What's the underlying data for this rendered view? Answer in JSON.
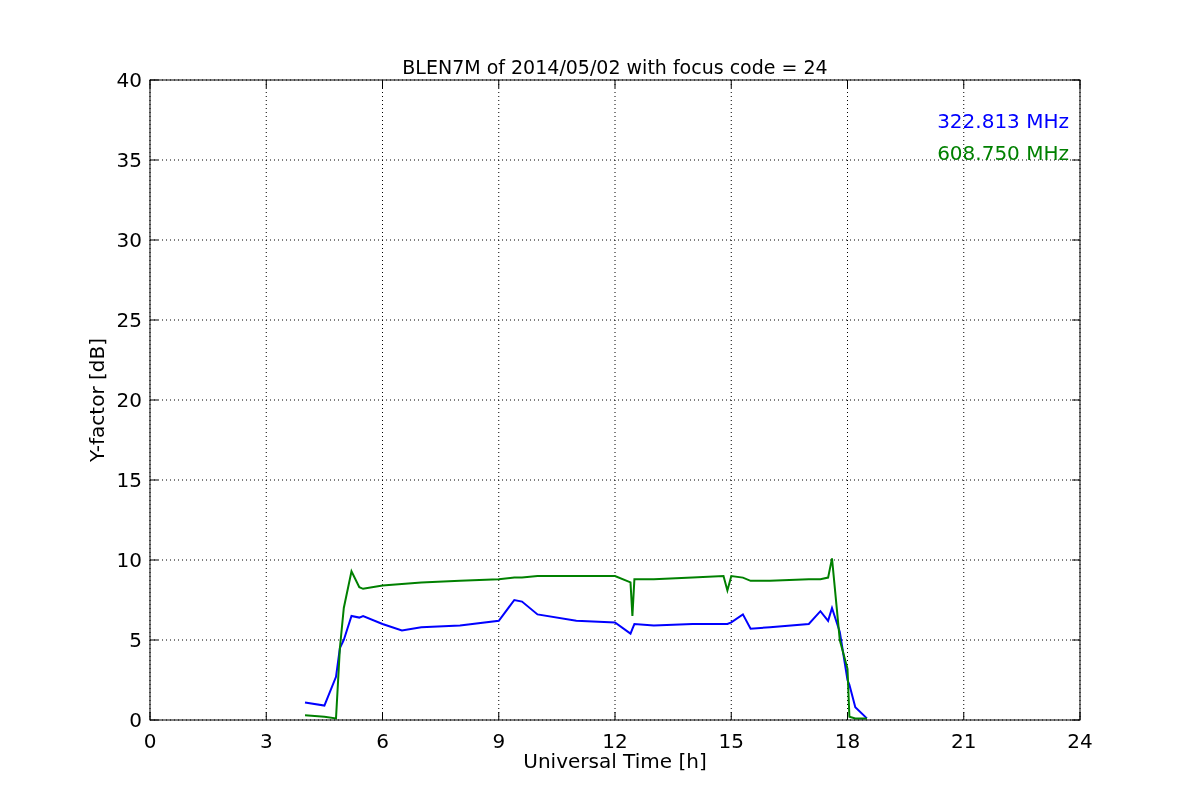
{
  "figure": {
    "chart_data": {
      "type": "line",
      "title": "BLEN7M of 2014/05/02 with focus code = 24",
      "xlabel": "Universal Time [h]",
      "ylabel": "Y-factor [dB]",
      "x": [
        4,
        4.5,
        4.8,
        4.9,
        5,
        5.2,
        5.4,
        5.5,
        6,
        6.5,
        7,
        8,
        9,
        9.4,
        9.6,
        10,
        11,
        12,
        12.4,
        12.45,
        12.5,
        13,
        14,
        14.8,
        14.9,
        15,
        15.3,
        15.5,
        16,
        17,
        17.3,
        17.5,
        17.6,
        17.8,
        18,
        18.05,
        18.2,
        18.5
      ],
      "series": [
        {
          "name": "322.813 MHz",
          "color": "#0000ff",
          "values": [
            1.1,
            0.9,
            2.7,
            4.5,
            5.0,
            6.5,
            6.4,
            6.5,
            6.0,
            5.6,
            5.8,
            5.9,
            6.2,
            7.5,
            7.4,
            6.6,
            6.2,
            6.1,
            5.4,
            5.7,
            6.0,
            5.9,
            6.0,
            6.0,
            6.0,
            6.1,
            6.6,
            5.7,
            5.8,
            6.0,
            6.8,
            6.2,
            7.0,
            5.5,
            2.5,
            2.2,
            0.8,
            0.1
          ]
        },
        {
          "name": "608.750 MHz",
          "color": "#008000",
          "values": [
            0.3,
            0.2,
            0.1,
            4.5,
            7.0,
            9.3,
            8.3,
            8.2,
            8.4,
            8.5,
            8.6,
            8.7,
            8.8,
            8.9,
            8.9,
            9.0,
            9.0,
            9.0,
            8.6,
            6.5,
            8.8,
            8.8,
            8.9,
            9.0,
            8.1,
            9.0,
            8.9,
            8.7,
            8.7,
            8.8,
            8.8,
            8.9,
            10.1,
            5.0,
            3.2,
            0.2,
            0.1,
            0.1
          ]
        }
      ],
      "grid": true,
      "xlim": [
        0,
        24
      ],
      "ylim": [
        0,
        40
      ],
      "xticks": [
        0,
        3,
        6,
        9,
        12,
        15,
        18,
        21,
        24
      ],
      "yticks": [
        0,
        5,
        10,
        15,
        20,
        25,
        30,
        35,
        40
      ]
    }
  }
}
